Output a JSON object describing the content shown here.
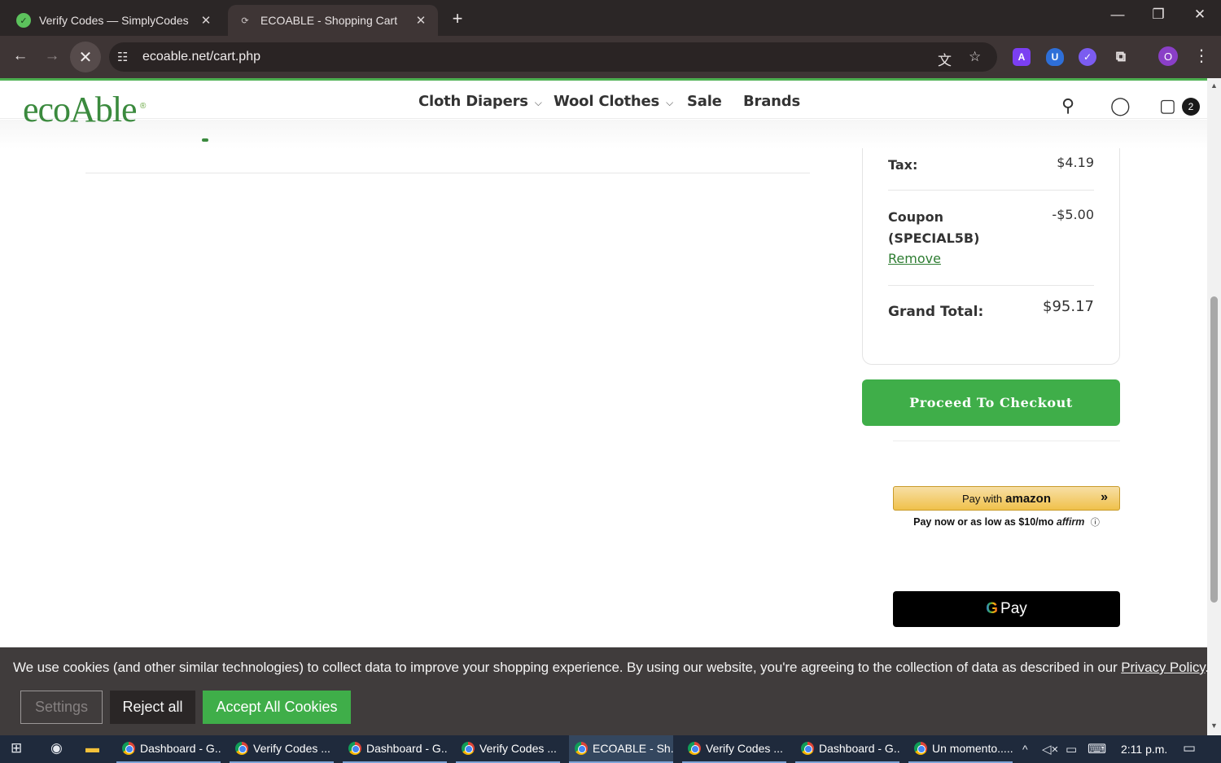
{
  "browser": {
    "tabs": [
      {
        "title": "Verify Codes — SimplyCodes",
        "active": false
      },
      {
        "title": "ECOABLE - Shopping Cart",
        "active": true
      }
    ],
    "url": "ecoable.net/cart.php",
    "profile_initial": "O"
  },
  "header": {
    "logo_text": "ecoAble",
    "nav": [
      {
        "label": "Cloth Diapers",
        "has_dropdown": true
      },
      {
        "label": "Wool Clothes",
        "has_dropdown": true
      },
      {
        "label": "Sale",
        "has_dropdown": false
      },
      {
        "label": "Brands",
        "has_dropdown": false
      }
    ],
    "cart_count": "2"
  },
  "summary": {
    "tax_label": "Tax:",
    "tax_value": "$4.19",
    "coupon_label": "Coupon (SPECIAL5B)",
    "coupon_value": "-$5.00",
    "coupon_remove": "Remove",
    "grand_total_label": "Grand Total:",
    "grand_total_value": "$95.17"
  },
  "checkout": {
    "proceed_label": "Proceed To Checkout",
    "amazon_prefix": "Pay with",
    "amazon_word": "amazon",
    "affirm_text": "Pay now or as low as $10/mo",
    "affirm_logo": "affirm",
    "gpay_g": "G",
    "gpay_label": "Pay"
  },
  "cookie": {
    "text": "We use cookies (and other similar technologies) to collect data to improve your shopping experience. By using our website, you're agreeing to the collection of data as described in our",
    "privacy_link": "Privacy Policy",
    "end": ".",
    "settings_label": "Settings",
    "reject_label": "Reject all",
    "accept_label": "Accept All Cookies"
  },
  "taskbar": {
    "items": [
      {
        "label": "Dashboard - G...",
        "active": false
      },
      {
        "label": "Verify Codes ...",
        "active": false
      },
      {
        "label": "Dashboard - G...",
        "active": false
      },
      {
        "label": "Verify Codes ...",
        "active": false
      },
      {
        "label": "ECOABLE - Sh...",
        "active": true
      },
      {
        "label": "Verify Codes ...",
        "active": false
      },
      {
        "label": "Dashboard - G...",
        "active": false
      },
      {
        "label": "Un momento.....",
        "active": false
      }
    ],
    "clock": "2:11 p.m."
  },
  "colors": {
    "brand_green": "#3b8a3e",
    "checkout_green": "#3fae49",
    "browser_dark": "#2b2626",
    "cookie_bg": "#403c3c"
  }
}
